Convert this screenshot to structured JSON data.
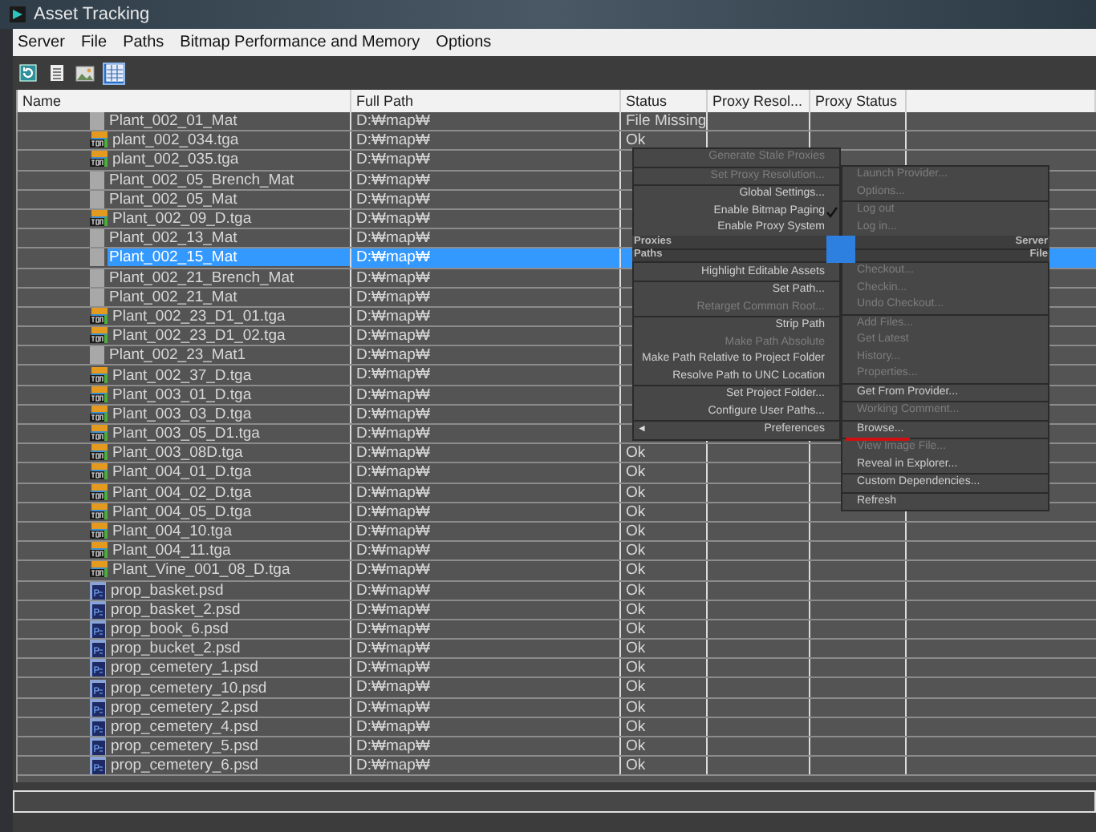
{
  "window": {
    "title": "Asset Tracking"
  },
  "menu_bar": [
    "Server",
    "File",
    "Paths",
    "Bitmap Performance and Memory",
    "Options"
  ],
  "toolbar": [
    {
      "kind": "refresh",
      "selected": false
    },
    {
      "kind": "list",
      "selected": false
    },
    {
      "kind": "image",
      "selected": false
    },
    {
      "kind": "grid",
      "selected": true
    }
  ],
  "table": {
    "columns": [
      "Name",
      "Full Path",
      "Status",
      "Proxy Resol...",
      "Proxy Status"
    ],
    "rows": [
      {
        "kind": "mat",
        "name": "Plant_002_01_Mat",
        "path": "D:₩map₩",
        "status": "File Missing",
        "selected": false
      },
      {
        "kind": "tga",
        "name": "plant_002_034.tga",
        "path": "D:₩map₩",
        "status": "Ok",
        "selected": false
      },
      {
        "kind": "tga",
        "name": "plant_002_035.tga",
        "path": "D:₩map₩",
        "selected": false
      },
      {
        "kind": "mat",
        "name": "Plant_002_05_Brench_Mat",
        "path": "D:₩map₩",
        "selected": false
      },
      {
        "kind": "mat",
        "name": "Plant_002_05_Mat",
        "path": "D:₩map₩",
        "selected": false
      },
      {
        "kind": "tga",
        "name": "Plant_002_09_D.tga",
        "path": "D:₩map₩",
        "selected": false
      },
      {
        "kind": "mat",
        "name": "Plant_002_13_Mat",
        "path": "D:₩map₩",
        "selected": false
      },
      {
        "kind": "mat",
        "name": "Plant_002_15_Mat",
        "path": "D:₩map₩",
        "selected": true
      },
      {
        "kind": "mat",
        "name": "Plant_002_21_Brench_Mat",
        "path": "D:₩map₩",
        "selected": false
      },
      {
        "kind": "mat",
        "name": "Plant_002_21_Mat",
        "path": "D:₩map₩",
        "selected": false
      },
      {
        "kind": "tga",
        "name": "Plant_002_23_D1_01.tga",
        "path": "D:₩map₩",
        "selected": false
      },
      {
        "kind": "tga",
        "name": "Plant_002_23_D1_02.tga",
        "path": "D:₩map₩",
        "selected": false
      },
      {
        "kind": "mat",
        "name": "Plant_002_23_Mat1",
        "path": "D:₩map₩",
        "selected": false
      },
      {
        "kind": "tga",
        "name": "Plant_002_37_D.tga",
        "path": "D:₩map₩",
        "selected": false
      },
      {
        "kind": "tga",
        "name": "Plant_003_01_D.tga",
        "path": "D:₩map₩",
        "selected": false
      },
      {
        "kind": "tga",
        "name": "Plant_003_03_D.tga",
        "path": "D:₩map₩",
        "selected": false
      },
      {
        "kind": "tga",
        "name": "Plant_003_05_D1.tga",
        "path": "D:₩map₩",
        "selected": false
      },
      {
        "kind": "tga",
        "name": "Plant_003_08D.tga",
        "path": "D:₩map₩",
        "status": "Ok",
        "selected": false
      },
      {
        "kind": "tga",
        "name": "Plant_004_01_D.tga",
        "path": "D:₩map₩",
        "status": "Ok",
        "selected": false
      },
      {
        "kind": "tga",
        "name": "Plant_004_02_D.tga",
        "path": "D:₩map₩",
        "status": "Ok",
        "selected": false
      },
      {
        "kind": "tga",
        "name": "Plant_004_05_D.tga",
        "path": "D:₩map₩",
        "status": "Ok",
        "selected": false
      },
      {
        "kind": "tga",
        "name": "Plant_004_10.tga",
        "path": "D:₩map₩",
        "status": "Ok",
        "selected": false
      },
      {
        "kind": "tga",
        "name": "Plant_004_11.tga",
        "path": "D:₩map₩",
        "status": "Ok",
        "selected": false
      },
      {
        "kind": "tga",
        "name": "Plant_Vine_001_08_D.tga",
        "path": "D:₩map₩",
        "status": "Ok",
        "selected": false
      },
      {
        "kind": "psd",
        "name": "prop_basket.psd",
        "path": "D:₩map₩",
        "status": "Ok",
        "selected": false
      },
      {
        "kind": "psd",
        "name": "prop_basket_2.psd",
        "path": "D:₩map₩",
        "status": "Ok",
        "selected": false
      },
      {
        "kind": "psd",
        "name": "prop_book_6.psd",
        "path": "D:₩map₩",
        "status": "Ok",
        "selected": false
      },
      {
        "kind": "psd",
        "name": "prop_bucket_2.psd",
        "path": "D:₩map₩",
        "status": "Ok",
        "selected": false
      },
      {
        "kind": "psd",
        "name": "prop_cemetery_1.psd",
        "path": "D:₩map₩",
        "status": "Ok",
        "selected": false
      },
      {
        "kind": "psd",
        "name": "prop_cemetery_10.psd",
        "path": "D:₩map₩",
        "status": "Ok",
        "selected": false
      },
      {
        "kind": "psd",
        "name": "prop_cemetery_2.psd",
        "path": "D:₩map₩",
        "status": "Ok",
        "selected": false
      },
      {
        "kind": "psd",
        "name": "prop_cemetery_4.psd",
        "path": "D:₩map₩",
        "status": "Ok",
        "selected": false
      },
      {
        "kind": "psd",
        "name": "prop_cemetery_5.psd",
        "path": "D:₩map₩",
        "status": "Ok",
        "selected": false
      },
      {
        "kind": "psd",
        "name": "prop_cemetery_6.psd",
        "path": "D:₩map₩",
        "status": "Ok",
        "selected": false
      }
    ]
  },
  "quad_menu": {
    "top_left": {
      "label": "Proxies",
      "groups": [
        [
          {
            "label": "Generate Stale Proxies",
            "disabled": true,
            "checked": false
          }
        ],
        [
          {
            "label": "Set Proxy Resolution...",
            "disabled": true,
            "checked": false
          }
        ],
        [
          {
            "label": "Global Settings...",
            "disabled": false,
            "checked": false
          },
          {
            "label": "Enable Bitmap Paging",
            "disabled": false,
            "checked": true
          },
          {
            "label": "Enable Proxy System",
            "disabled": false,
            "checked": false
          }
        ]
      ]
    },
    "bottom_left": {
      "label": "Paths",
      "groups": [
        [
          {
            "label": "Highlight Editable Assets",
            "disabled": false,
            "checked": false
          }
        ],
        [
          {
            "label": "Set Path...",
            "disabled": false,
            "checked": false
          },
          {
            "label": "Retarget Common Root...",
            "disabled": true,
            "checked": false
          }
        ],
        [
          {
            "label": "Strip Path",
            "disabled": false,
            "checked": false
          },
          {
            "label": "Make Path Absolute",
            "disabled": true,
            "checked": false
          },
          {
            "label": "Make Path Relative to Project Folder",
            "disabled": false,
            "checked": false
          },
          {
            "label": "Resolve Path to UNC Location",
            "disabled": false,
            "checked": false
          }
        ],
        [
          {
            "label": "Set Project Folder...",
            "disabled": false,
            "checked": false
          },
          {
            "label": "Configure User Paths...",
            "disabled": false,
            "checked": false
          }
        ],
        [
          {
            "label": "Preferences",
            "arrow": "◄",
            "disabled": false,
            "checked": false
          }
        ]
      ]
    },
    "top_right": {
      "label": "Server",
      "groups": [
        [
          {
            "label": "Launch Provider...",
            "disabled": true,
            "marked": false
          },
          {
            "label": "Options...",
            "disabled": true,
            "marked": false
          }
        ],
        [
          {
            "label": "Log out",
            "disabled": true,
            "marked": false
          },
          {
            "label": "Log in...",
            "disabled": true,
            "marked": false
          }
        ]
      ]
    },
    "bottom_right": {
      "label": "File",
      "groups": [
        [
          {
            "label": "Checkout...",
            "disabled": true,
            "marked": false
          },
          {
            "label": "Checkin...",
            "disabled": true,
            "marked": false
          },
          {
            "label": "Undo Checkout...",
            "disabled": true,
            "marked": false
          }
        ],
        [
          {
            "label": "Add Files...",
            "disabled": true,
            "marked": false
          },
          {
            "label": "Get Latest",
            "disabled": true,
            "marked": false
          },
          {
            "label": "History...",
            "disabled": true,
            "marked": false
          },
          {
            "label": "Properties...",
            "disabled": true,
            "marked": false
          }
        ],
        [
          {
            "label": "Get From Provider...",
            "disabled": false,
            "marked": false
          }
        ],
        [
          {
            "label": "Working Comment...",
            "disabled": true,
            "marked": false
          }
        ],
        [
          {
            "label": "Browse...",
            "disabled": false,
            "marked": true
          }
        ],
        [
          {
            "label": "View Image File...",
            "disabled": true,
            "marked": false
          },
          {
            "label": "Reveal in Explorer...",
            "disabled": false,
            "marked": false
          }
        ],
        [
          {
            "label": "Custom Dependencies...",
            "disabled": false,
            "marked": false
          }
        ],
        [
          {
            "label": "Refresh",
            "disabled": false,
            "marked": false
          }
        ]
      ]
    }
  }
}
